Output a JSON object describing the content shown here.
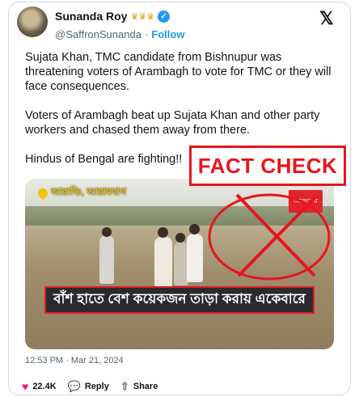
{
  "tweet": {
    "display_name": "Sunanda Roy",
    "handle": "@SaffronSunanda",
    "separator": "·",
    "follow_label": "Follow",
    "paragraphs": [
      "Sujata Khan, TMC candidate from Bishnupur was threatening voters of Arambagh to vote for TMC or they will face consequences.",
      "Voters of Arambagh beat up Sujata Khan and other party workers and chased them away from there.",
      "Hindus of Bengal are fighting!!"
    ],
    "timestamp": "12:53 PM · Mar 21, 2024"
  },
  "overlay": {
    "fact_check_label": "FACT CHECK"
  },
  "media": {
    "location_tag": "আরাণ্ডি, আরামবাগ",
    "channel_tag": "আজকের",
    "caption": "বাঁশ হাতে বেশ কয়েকজন তাড়া করায় একেবারে"
  },
  "actions": {
    "likes": "22.4K",
    "reply_label": "Reply",
    "share_label": "Share"
  },
  "icons": {
    "verified": "verified-badge-icon",
    "logo": "x-logo-icon",
    "like": "heart-icon",
    "reply": "speech-bubble-icon",
    "share": "share-icon"
  },
  "colors": {
    "accent": "#1d9bf0",
    "fact_check_red": "#e8141c",
    "like_pink": "#f91880"
  }
}
